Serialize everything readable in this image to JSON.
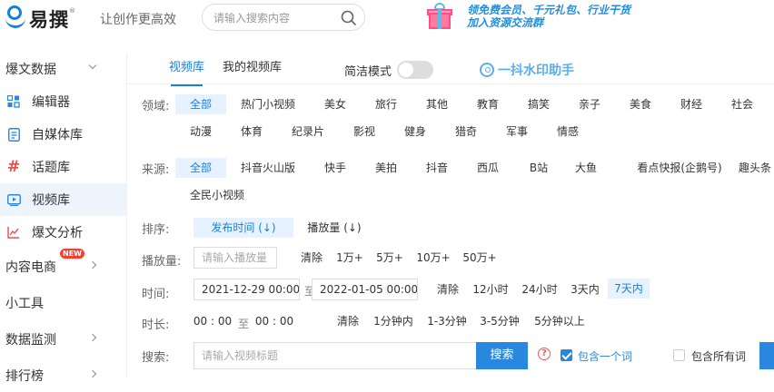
{
  "brand": {
    "name": "易撰",
    "reg": "®",
    "slogan": "让创作更高效"
  },
  "search": {
    "placeholder": "请输入搜索内容"
  },
  "promo": {
    "line1": "领免费会员、千元礼包、行业干货",
    "line2": "加入资源交流群"
  },
  "sidebar": {
    "items": [
      {
        "label": "爆文数据",
        "type": "group",
        "chevron": "down"
      },
      {
        "label": "编辑器",
        "icon": "grid-icon"
      },
      {
        "label": "自媒体库",
        "icon": "document-icon"
      },
      {
        "label": "话题库",
        "icon": "hashtag-icon"
      },
      {
        "label": "视频库",
        "icon": "video-icon",
        "active": true
      },
      {
        "label": "爆文分析",
        "icon": "chart-icon"
      },
      {
        "label": "内容电商",
        "type": "group",
        "chevron": "right",
        "badge": "NEW"
      },
      {
        "label": "小工具",
        "type": "group"
      },
      {
        "label": "数据监测",
        "type": "group",
        "chevron": "right"
      },
      {
        "label": "排行榜",
        "type": "group",
        "chevron": "right"
      }
    ]
  },
  "tabs": [
    {
      "label": "视频库",
      "active": true
    },
    {
      "label": "我的视频库"
    }
  ],
  "simple_mode": {
    "label": "简洁模式",
    "on": false
  },
  "watermark_helper": "一抖水印助手",
  "filters": {
    "domain": {
      "label": "领域:",
      "row1": [
        "全部",
        "热门小视频",
        "美女",
        "旅行",
        "其他",
        "教育",
        "搞笑",
        "亲子",
        "美食",
        "财经",
        "社会"
      ],
      "row2": [
        "动漫",
        "体育",
        "纪录片",
        "影视",
        "健身",
        "猎奇",
        "军事",
        "情感"
      ],
      "active": "全部"
    },
    "source": {
      "label": "来源:",
      "row1": [
        "全部",
        "抖音火山版",
        "快手",
        "美拍",
        "抖音",
        "西瓜",
        "B站",
        "大鱼",
        "看点快报(企鹅号)",
        "趣头条"
      ],
      "row2": [
        "全民小视频"
      ],
      "active": "全部"
    },
    "sort": {
      "label": "排序:",
      "options": [
        "发布时间 (↓)",
        "播放量 (↓)"
      ],
      "active": "发布时间 (↓)"
    },
    "plays": {
      "label": "播放量:",
      "placeholder": "请输入播放量",
      "options": [
        "清除",
        "1万+",
        "5万+",
        "10万+",
        "50万+"
      ]
    },
    "time": {
      "label": "时间:",
      "start": "2021-12-29 00:00",
      "to": "至",
      "end": "2022-01-05 00:00",
      "options": [
        "清除",
        "12小时",
        "24小时",
        "3天内",
        "7天内"
      ],
      "active": "7天内"
    },
    "duration": {
      "label": "时长:",
      "from": "00 : 00",
      "to_word": "至",
      "to": "00 : 00",
      "options": [
        "清除",
        "1分钟内",
        "1-3分钟",
        "3-5分钟",
        "5分钟以上"
      ]
    },
    "query": {
      "label": "搜索:",
      "placeholder": "请输入视频标题",
      "button": "搜索",
      "help": "?",
      "contains_one": "包含一个词",
      "contains_one_checked": true,
      "contains_all": "包含所有词",
      "contains_all_checked": false
    }
  },
  "colors": {
    "accent": "#2a87e0",
    "active_bg": "#e6f2ff",
    "badge": "#ff3b30"
  }
}
